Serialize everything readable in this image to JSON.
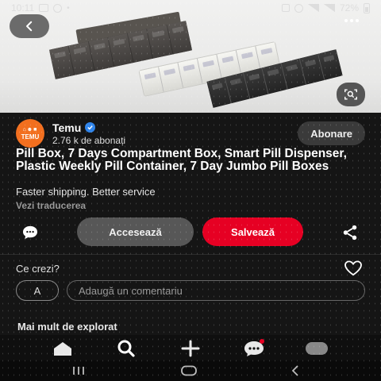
{
  "status_bar": {
    "time": "10:11",
    "battery": "72%"
  },
  "author": {
    "name": "Temu",
    "followers": "2.76 k de abonați",
    "follow_label": "Abonare"
  },
  "pin": {
    "title": "Pill Box, 7 Days Compartment Box, Smart Pill Dispenser, Plastic Weekly Pill Container, 7 Day Jumbo Pill Boxes",
    "description": "Faster shipping. Better service",
    "translate_label": "Vezi traducerea"
  },
  "actions": {
    "visit_label": "Accesează",
    "save_label": "Salvează"
  },
  "comments": {
    "prompt": "Ce crezi?",
    "user_initial": "A",
    "placeholder": "Adaugă un comentariu"
  },
  "explore": {
    "label": "Mai mult de explorat"
  },
  "colors": {
    "accent_red": "#e60023",
    "temu_orange": "#f26f1f",
    "verified_blue": "#2f84ea"
  },
  "icons": {
    "back": "chevron-left-icon",
    "more": "more-dots-icon",
    "lens": "visual-search-icon",
    "comment": "comment-bubble-icon",
    "share": "share-icon",
    "heart": "heart-icon",
    "nav": [
      "home-icon",
      "search-icon",
      "create-icon",
      "messages-icon",
      "profile-avatar"
    ]
  }
}
